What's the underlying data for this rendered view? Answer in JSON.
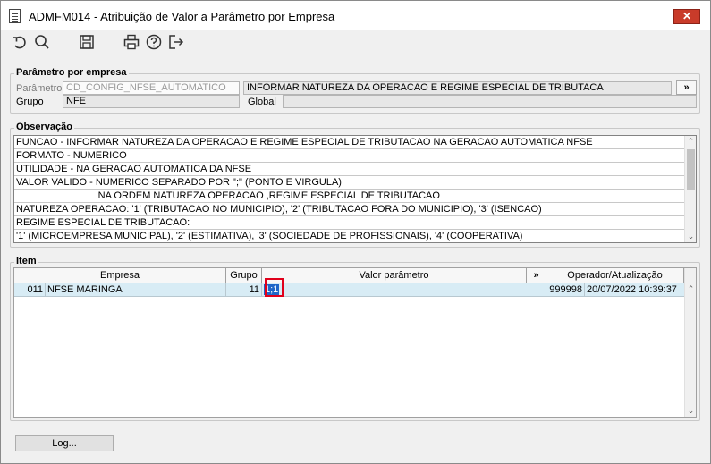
{
  "window": {
    "title": "ADMFM014 - Atribuição de Valor a Parâmetro por Empresa",
    "close_label": "✕"
  },
  "toolbar": {
    "icons": [
      "undo-icon",
      "search-icon",
      "save-icon",
      "print-icon",
      "help-icon",
      "exit-icon"
    ]
  },
  "parametro_empresa": {
    "legend": "Parâmetro por empresa",
    "parametro_label": "Parâmetro",
    "parametro_value": "CD_CONFIG_NFSE_AUTOMATICO",
    "descricao_value": "INFORMAR NATUREZA DA OPERACAO E REGIME ESPECIAL DE TRIBUTACA",
    "expand_label": "»",
    "grupo_label": "Grupo",
    "grupo_value": "NFE",
    "global_label": "Global",
    "global_value": ""
  },
  "observacao": {
    "legend": "Observação",
    "lines": [
      "FUNCAO - INFORMAR NATUREZA DA OPERACAO E REGIME ESPECIAL DE TRIBUTACAO NA GERACAO AUTOMATICA NFSE",
      "FORMATO - NUMERICO",
      "UTILIDADE - NA GERACAO AUTOMATICA DA NFSE",
      "VALOR VALIDO - NUMERICO SEPARADO POR \";\" (PONTO E VIRGULA)",
      "                              NA ORDEM NATUREZA OPERACAO ,REGIME ESPECIAL DE TRIBUTACAO",
      "NATUREZA OPERACAO: '1' (TRIBUTACAO NO MUNICIPIO), '2' (TRIBUTACAO FORA DO MUNICIPIO), '3' (ISENCAO)",
      "REGIME ESPECIAL DE TRIBUTACAO:",
      "'1' (MICROEMPRESA MUNICIPAL), '2' (ESTIMATIVA), '3' (SOCIEDADE DE PROFISSIONAIS), '4' (COOPERATIVA)"
    ]
  },
  "item": {
    "legend": "Item",
    "columns": {
      "empresa": "Empresa",
      "grupo": "Grupo",
      "valor": "Valor parâmetro",
      "expand": "»",
      "operador": "Operador/Atualização"
    },
    "rows": [
      {
        "codigo": "011",
        "empresa": "NFSE MARINGA",
        "grupo": "11",
        "valor": "1;1",
        "operador": "999998",
        "atualizacao": "20/07/2022 10:39:37"
      }
    ]
  },
  "footer": {
    "log_label": "Log..."
  },
  "colors": {
    "accent": "#1e66c8",
    "row_highlight": "#d8ecf5",
    "focus_border": "#e0001b",
    "close_button": "#c93b2a"
  }
}
